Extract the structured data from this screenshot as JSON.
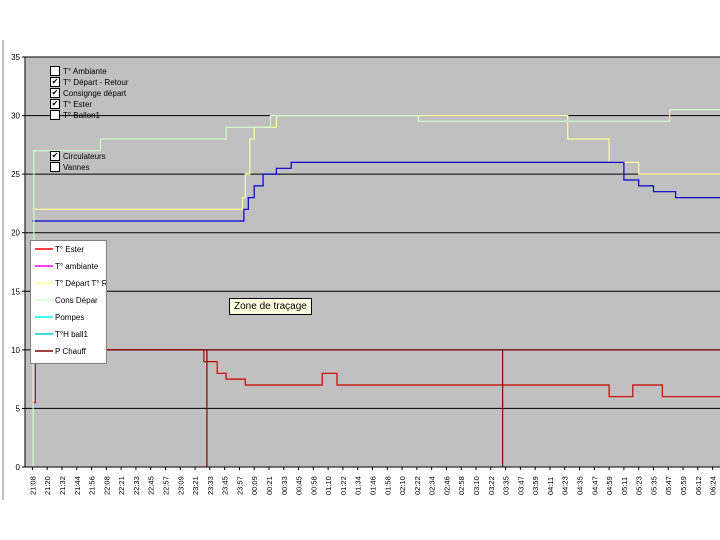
{
  "chart_data": {
    "type": "line",
    "ylim": [
      0,
      35
    ],
    "yticks": [
      0,
      5,
      10,
      15,
      20,
      25,
      30,
      35
    ],
    "xticks": [
      "21:08",
      "21:20",
      "21:32",
      "21:44",
      "21:56",
      "22:08",
      "22:21",
      "22:33",
      "22:45",
      "22:57",
      "23:09",
      "23:21",
      "23:33",
      "23:45",
      "23:57",
      "00:09",
      "00:21",
      "00:33",
      "00:45",
      "00:58",
      "01:10",
      "01:22",
      "01:34",
      "01:46",
      "01:58",
      "02:10",
      "02:22",
      "02:34",
      "02:46",
      "02:58",
      "03:10",
      "03:22",
      "03:35",
      "03:47",
      "03:59",
      "04:11",
      "04:23",
      "04:35",
      "04:47",
      "04:59",
      "05:11",
      "05:23",
      "05:35",
      "05:47",
      "05:59",
      "06:12",
      "06:24"
    ],
    "grid": true,
    "background": "#c0c0c0",
    "series": [
      {
        "name": "T° Départ - Retour",
        "color": "#ffff99",
        "x": [
          0,
          4.8,
          5.0,
          13.5,
          14.0,
          14.2,
          14.4,
          14.7,
          15.0,
          15.8,
          16.5,
          25.0,
          26.5,
          35.0,
          36.2,
          37.0,
          37.8,
          38.5,
          39.0,
          40.0,
          41.0,
          42.0,
          43.0,
          44.0,
          46.5
        ],
        "y": [
          22,
          22,
          22,
          22,
          22,
          23,
          25,
          28,
          29,
          29,
          30,
          30,
          30,
          30,
          28,
          28,
          28,
          28,
          26,
          26,
          25,
          25,
          25,
          25,
          25
        ]
      },
      {
        "name": "Consignge départ",
        "color": "#ccffcc",
        "x": [
          0,
          4.5,
          4.6,
          13.0,
          13.1,
          16.0,
          16.1,
          26.0,
          26.1,
          43.0,
          43.1,
          46.5
        ],
        "y": [
          27,
          27,
          28,
          28,
          29,
          29,
          30,
          30,
          29.5,
          29.5,
          30.5,
          30.5
        ]
      },
      {
        "name": "T° Ester",
        "color": "#0000cc",
        "x": [
          0,
          13.6,
          14.0,
          14.3,
          14.6,
          15.0,
          15.6,
          16.5,
          17.5,
          30.0,
          39.0,
          40.0,
          41.0,
          42.0,
          43.5,
          46.5
        ],
        "y": [
          21,
          21,
          21,
          22,
          23,
          24,
          25,
          25.5,
          26,
          26,
          26,
          24.5,
          24,
          23.5,
          23,
          23
        ]
      },
      {
        "name": "T° Ester",
        "color": "#cc0000",
        "x": [
          0,
          0.2,
          0.3,
          11.5,
          11.6,
          12.4,
          12.5,
          13.0,
          13.1,
          14.3,
          14.4,
          19.5,
          19.6,
          20.5,
          20.6,
          38.9,
          39.0,
          40.5,
          40.6,
          42.5,
          42.6,
          46.5
        ],
        "y": [
          5.5,
          11,
          10,
          10,
          9,
          9,
          8,
          8,
          7.5,
          7.5,
          7,
          7,
          8,
          8,
          7,
          7,
          6,
          6,
          7,
          7,
          6,
          6
        ]
      },
      {
        "name": "P Chauff",
        "color": "#800000",
        "x": [
          0,
          11.8,
          11.8,
          11.8,
          11.8,
          31.8,
          31.8,
          31.8,
          31.8,
          46.5
        ],
        "y": [
          10,
          10,
          5,
          0,
          10,
          10,
          5,
          0,
          10,
          10
        ]
      },
      {
        "name": "Cons Dépar",
        "color": "#ccffcc",
        "x": [
          0,
          0.05,
          0.1
        ],
        "y": [
          0,
          14,
          27
        ]
      }
    ],
    "legend_entries": [
      {
        "name": "T° Ester",
        "color": "#ff0000"
      },
      {
        "name": "T° ambiante",
        "color": "#ff00ff"
      },
      {
        "name": "T° Départ T° Retour",
        "color": "#ffff99"
      },
      {
        "name": "Cons Dépar",
        "color": "#ccffcc"
      },
      {
        "name": "Pompes",
        "color": "#00ffff"
      },
      {
        "name": "T°H ball1",
        "color": "#00cccc"
      },
      {
        "name": "P Chauff",
        "color": "#800000"
      }
    ]
  },
  "checkboxes": [
    {
      "label": "T° Ambiante",
      "checked": false
    },
    {
      "label": "T° Départ - Retour",
      "checked": true
    },
    {
      "label": "Consignge départ",
      "checked": true
    },
    {
      "label": "T° Ester",
      "checked": true
    },
    {
      "label": "T° Ballon1",
      "checked": false
    }
  ],
  "checkboxes2": [
    {
      "label": "Circulateurs",
      "checked": true
    },
    {
      "label": "Vannes",
      "checked": false
    }
  ],
  "tooltip": "Zone de traçage"
}
